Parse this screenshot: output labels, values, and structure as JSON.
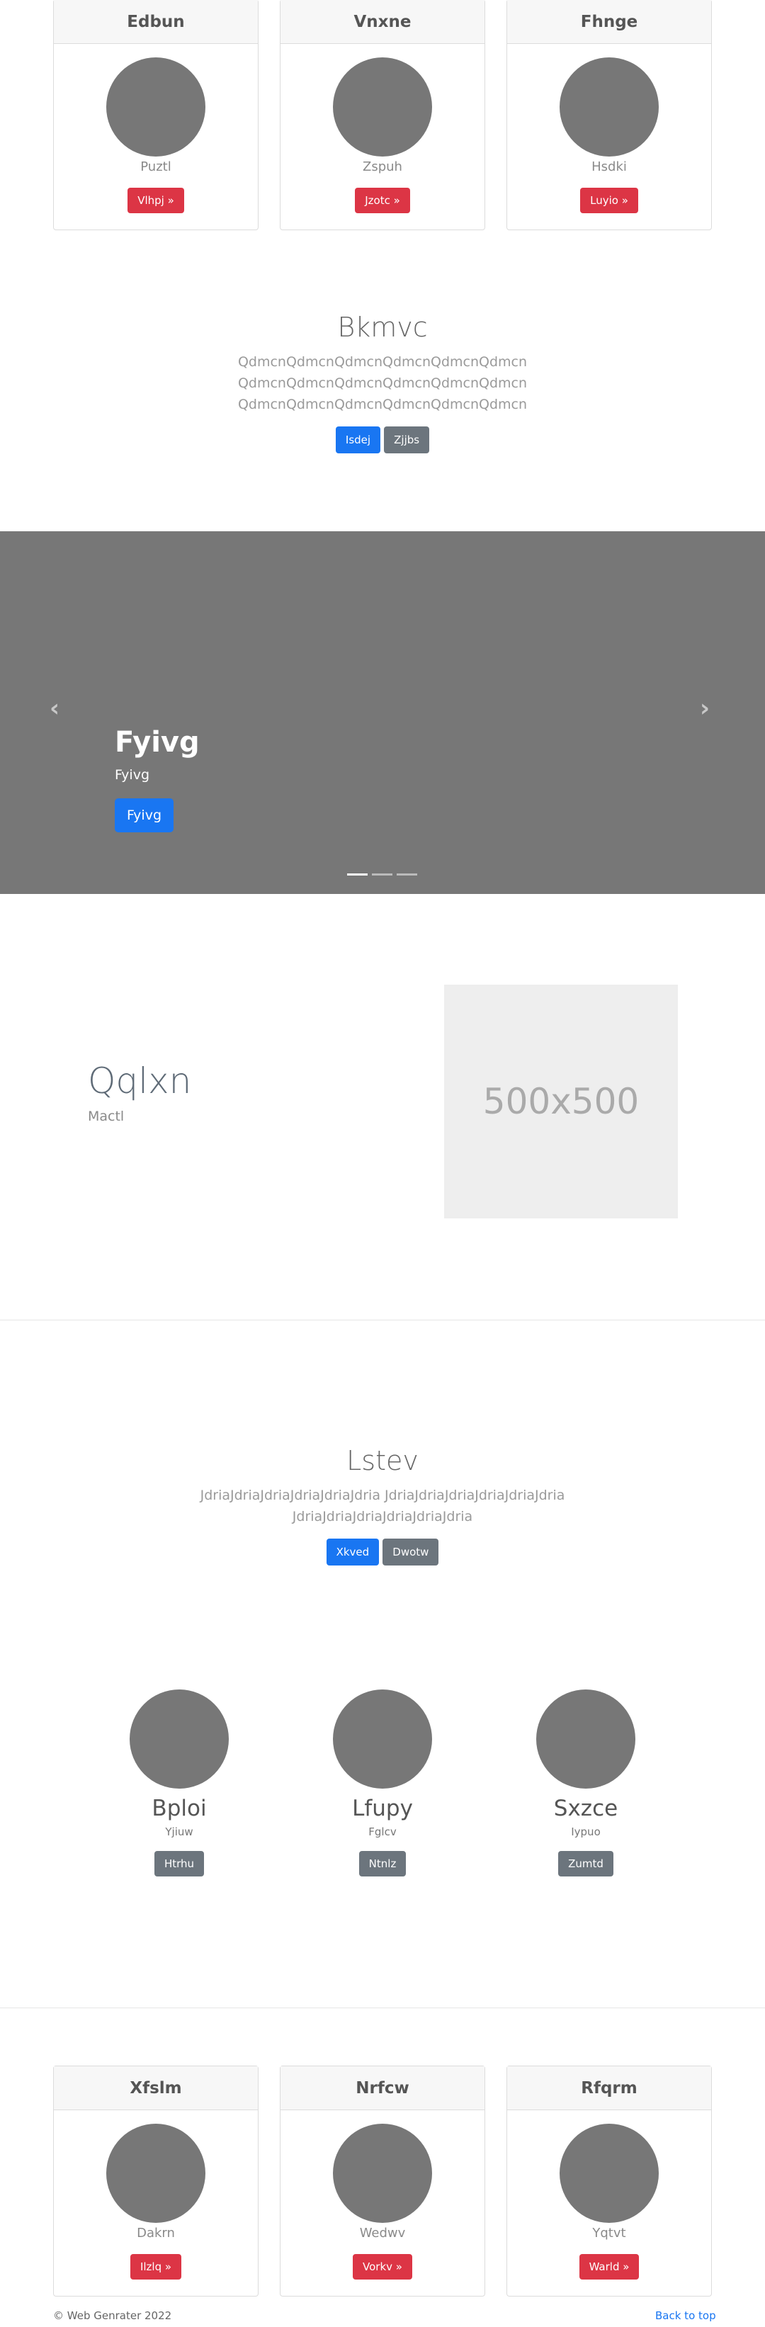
{
  "top_cards": [
    {
      "title": "Edbun",
      "subtitle": "Puztl",
      "button": "Vlhpj »"
    },
    {
      "title": "Vnxne",
      "subtitle": "Zspuh",
      "button": "Jzotc »"
    },
    {
      "title": "Fhnge",
      "subtitle": "Hsdki",
      "button": "Luyio »"
    }
  ],
  "hero": {
    "title": "Bkmvc",
    "lines": [
      "QdmcnQdmcnQdmcnQdmcnQdmcnQdmcn",
      "QdmcnQdmcnQdmcnQdmcnQdmcnQdmcn",
      "QdmcnQdmcnQdmcnQdmcnQdmcnQdmcn"
    ],
    "primary_button": "Isdej",
    "secondary_button": "Zjjbs"
  },
  "carousel": {
    "title": "Fyivg",
    "text": "Fyivg",
    "button": "Fyivg",
    "prev_icon": "chevron-left",
    "next_icon": "chevron-right",
    "indicator_count": 3,
    "active_indicator": 1
  },
  "feature": {
    "title": "Qqlxn",
    "subtitle": "Mactl",
    "image_label": "500x500"
  },
  "section2": {
    "title": "Lstev",
    "lines": [
      "JdriaJdriaJdriaJdriaJdriaJdria JdriaJdriaJdriaJdriaJdriaJdria",
      "JdriaJdriaJdriaJdriaJdriaJdria"
    ],
    "primary_button": "Xkved",
    "secondary_button": "Dwotw"
  },
  "team": [
    {
      "name": "Bploi",
      "role": "Yjiuw",
      "button": "Htrhu"
    },
    {
      "name": "Lfupy",
      "role": "Fglcv",
      "button": "Ntnlz"
    },
    {
      "name": "Sxzce",
      "role": "Iypuo",
      "button": "Zumtd"
    }
  ],
  "bottom_cards": [
    {
      "title": "Xfslm",
      "subtitle": "Dakrn",
      "button": "Ilzlq »"
    },
    {
      "title": "Nrfcw",
      "subtitle": "Wedwv",
      "button": "Vorkv »"
    },
    {
      "title": "Rfqrm",
      "subtitle": "Yqtvt",
      "button": "Warld »"
    }
  ],
  "footer": {
    "copyright": "© Web Genrater 2022",
    "back_to_top": "Back to top"
  },
  "colors": {
    "primary": "#1976f2",
    "danger": "#dc3545",
    "secondary": "#6c757d",
    "placeholder_gray": "#777777"
  }
}
